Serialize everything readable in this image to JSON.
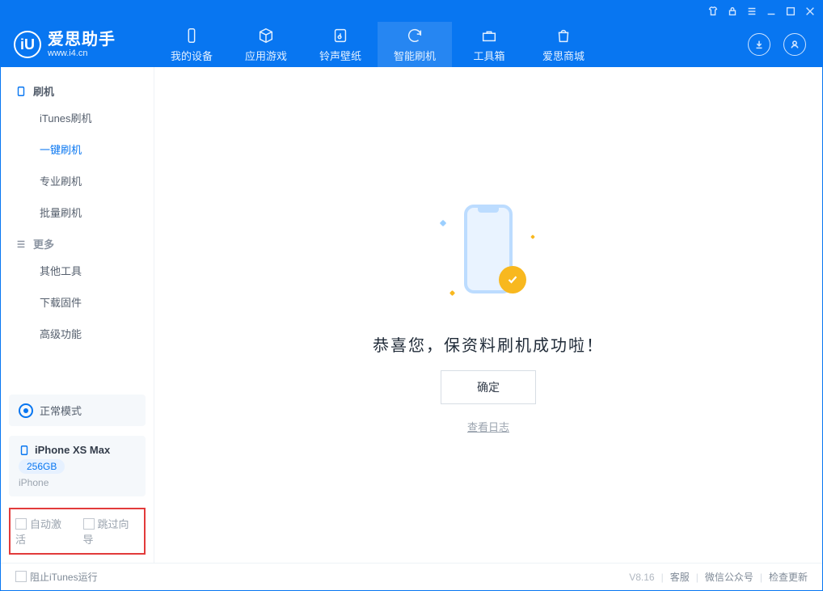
{
  "brand": {
    "name": "爱思助手",
    "site": "www.i4.cn",
    "logo_letter": "iU"
  },
  "topnav": [
    {
      "id": "device",
      "label": "我的设备"
    },
    {
      "id": "apps",
      "label": "应用游戏"
    },
    {
      "id": "ring",
      "label": "铃声壁纸"
    },
    {
      "id": "flash",
      "label": "智能刷机"
    },
    {
      "id": "tools",
      "label": "工具箱"
    },
    {
      "id": "store",
      "label": "爱思商城"
    }
  ],
  "sidebar": {
    "groups": [
      {
        "title": "刷机",
        "items": [
          {
            "id": "itunes",
            "label": "iTunes刷机"
          },
          {
            "id": "onekey",
            "label": "一键刷机",
            "active": true
          },
          {
            "id": "pro",
            "label": "专业刷机"
          },
          {
            "id": "batch",
            "label": "批量刷机"
          }
        ]
      },
      {
        "title": "更多",
        "items": [
          {
            "id": "other",
            "label": "其他工具"
          },
          {
            "id": "fw",
            "label": "下载固件"
          },
          {
            "id": "adv",
            "label": "高级功能"
          }
        ]
      }
    ],
    "mode": "正常模式",
    "device": {
      "name": "iPhone XS Max",
      "capacity": "256GB",
      "platform": "iPhone"
    },
    "options": {
      "auto_activate": "自动激活",
      "skip_guide": "跳过向导"
    }
  },
  "main": {
    "headline": "恭喜您，保资料刷机成功啦！",
    "ok": "确定",
    "view_log": "查看日志"
  },
  "footer": {
    "block_itunes": "阻止iTunes运行",
    "version": "V8.16",
    "links": {
      "cs": "客服",
      "wx": "微信公众号",
      "update": "检查更新"
    }
  }
}
